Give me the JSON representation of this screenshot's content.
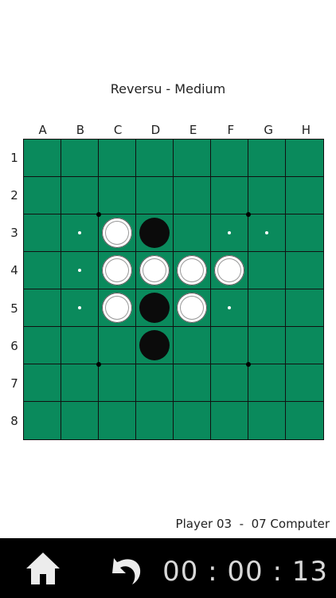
{
  "game": {
    "title": "Reversu - Medium",
    "columns": [
      "A",
      "B",
      "C",
      "D",
      "E",
      "F",
      "G",
      "H"
    ],
    "rows": [
      "1",
      "2",
      "3",
      "4",
      "5",
      "6",
      "7",
      "8"
    ],
    "pieces": [
      {
        "cell": "C3",
        "color": "white"
      },
      {
        "cell": "D3",
        "color": "black"
      },
      {
        "cell": "C4",
        "color": "white"
      },
      {
        "cell": "D4",
        "color": "white"
      },
      {
        "cell": "E4",
        "color": "white"
      },
      {
        "cell": "F4",
        "color": "white"
      },
      {
        "cell": "C5",
        "color": "white"
      },
      {
        "cell": "D5",
        "color": "black"
      },
      {
        "cell": "E5",
        "color": "white"
      },
      {
        "cell": "D6",
        "color": "black"
      }
    ],
    "valid_moves": [
      "B3",
      "F3",
      "G3",
      "B4",
      "B5",
      "F5"
    ],
    "colors": {
      "board": "#0a8a5c",
      "grid": "#111111",
      "white_piece": "#ffffff",
      "black_piece": "#0b0b0b",
      "bar": "#000000"
    }
  },
  "score": {
    "text": "Player 03  -  07 Computer"
  },
  "controls": {
    "home_icon": "home-icon",
    "undo_icon": "undo-icon",
    "timer": "00 : 00 : 13"
  }
}
